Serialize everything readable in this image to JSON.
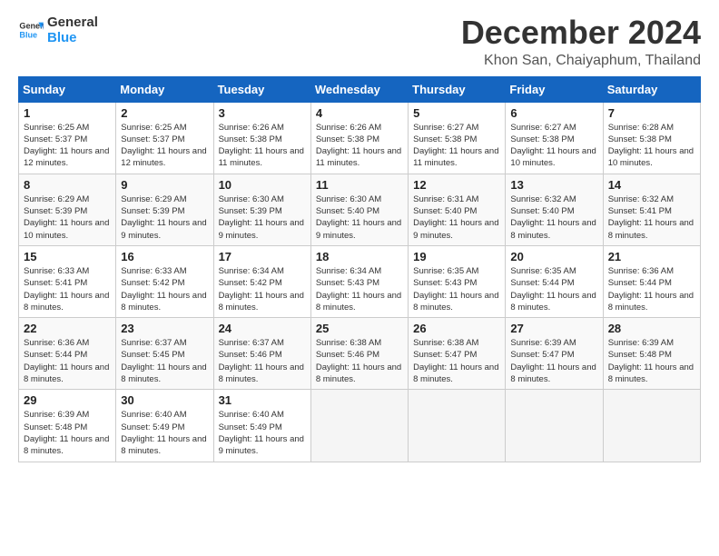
{
  "header": {
    "logo_line1": "General",
    "logo_line2": "Blue",
    "month_title": "December 2024",
    "location": "Khon San, Chaiyaphum, Thailand"
  },
  "weekdays": [
    "Sunday",
    "Monday",
    "Tuesday",
    "Wednesday",
    "Thursday",
    "Friday",
    "Saturday"
  ],
  "weeks": [
    [
      {
        "day": "1",
        "sunrise": "6:25 AM",
        "sunset": "5:37 PM",
        "daylight": "11 hours and 12 minutes."
      },
      {
        "day": "2",
        "sunrise": "6:25 AM",
        "sunset": "5:37 PM",
        "daylight": "11 hours and 12 minutes."
      },
      {
        "day": "3",
        "sunrise": "6:26 AM",
        "sunset": "5:38 PM",
        "daylight": "11 hours and 11 minutes."
      },
      {
        "day": "4",
        "sunrise": "6:26 AM",
        "sunset": "5:38 PM",
        "daylight": "11 hours and 11 minutes."
      },
      {
        "day": "5",
        "sunrise": "6:27 AM",
        "sunset": "5:38 PM",
        "daylight": "11 hours and 11 minutes."
      },
      {
        "day": "6",
        "sunrise": "6:27 AM",
        "sunset": "5:38 PM",
        "daylight": "11 hours and 10 minutes."
      },
      {
        "day": "7",
        "sunrise": "6:28 AM",
        "sunset": "5:38 PM",
        "daylight": "11 hours and 10 minutes."
      }
    ],
    [
      {
        "day": "8",
        "sunrise": "6:29 AM",
        "sunset": "5:39 PM",
        "daylight": "11 hours and 10 minutes."
      },
      {
        "day": "9",
        "sunrise": "6:29 AM",
        "sunset": "5:39 PM",
        "daylight": "11 hours and 9 minutes."
      },
      {
        "day": "10",
        "sunrise": "6:30 AM",
        "sunset": "5:39 PM",
        "daylight": "11 hours and 9 minutes."
      },
      {
        "day": "11",
        "sunrise": "6:30 AM",
        "sunset": "5:40 PM",
        "daylight": "11 hours and 9 minutes."
      },
      {
        "day": "12",
        "sunrise": "6:31 AM",
        "sunset": "5:40 PM",
        "daylight": "11 hours and 9 minutes."
      },
      {
        "day": "13",
        "sunrise": "6:32 AM",
        "sunset": "5:40 PM",
        "daylight": "11 hours and 8 minutes."
      },
      {
        "day": "14",
        "sunrise": "6:32 AM",
        "sunset": "5:41 PM",
        "daylight": "11 hours and 8 minutes."
      }
    ],
    [
      {
        "day": "15",
        "sunrise": "6:33 AM",
        "sunset": "5:41 PM",
        "daylight": "11 hours and 8 minutes."
      },
      {
        "day": "16",
        "sunrise": "6:33 AM",
        "sunset": "5:42 PM",
        "daylight": "11 hours and 8 minutes."
      },
      {
        "day": "17",
        "sunrise": "6:34 AM",
        "sunset": "5:42 PM",
        "daylight": "11 hours and 8 minutes."
      },
      {
        "day": "18",
        "sunrise": "6:34 AM",
        "sunset": "5:43 PM",
        "daylight": "11 hours and 8 minutes."
      },
      {
        "day": "19",
        "sunrise": "6:35 AM",
        "sunset": "5:43 PM",
        "daylight": "11 hours and 8 minutes."
      },
      {
        "day": "20",
        "sunrise": "6:35 AM",
        "sunset": "5:44 PM",
        "daylight": "11 hours and 8 minutes."
      },
      {
        "day": "21",
        "sunrise": "6:36 AM",
        "sunset": "5:44 PM",
        "daylight": "11 hours and 8 minutes."
      }
    ],
    [
      {
        "day": "22",
        "sunrise": "6:36 AM",
        "sunset": "5:44 PM",
        "daylight": "11 hours and 8 minutes."
      },
      {
        "day": "23",
        "sunrise": "6:37 AM",
        "sunset": "5:45 PM",
        "daylight": "11 hours and 8 minutes."
      },
      {
        "day": "24",
        "sunrise": "6:37 AM",
        "sunset": "5:46 PM",
        "daylight": "11 hours and 8 minutes."
      },
      {
        "day": "25",
        "sunrise": "6:38 AM",
        "sunset": "5:46 PM",
        "daylight": "11 hours and 8 minutes."
      },
      {
        "day": "26",
        "sunrise": "6:38 AM",
        "sunset": "5:47 PM",
        "daylight": "11 hours and 8 minutes."
      },
      {
        "day": "27",
        "sunrise": "6:39 AM",
        "sunset": "5:47 PM",
        "daylight": "11 hours and 8 minutes."
      },
      {
        "day": "28",
        "sunrise": "6:39 AM",
        "sunset": "5:48 PM",
        "daylight": "11 hours and 8 minutes."
      }
    ],
    [
      {
        "day": "29",
        "sunrise": "6:39 AM",
        "sunset": "5:48 PM",
        "daylight": "11 hours and 8 minutes."
      },
      {
        "day": "30",
        "sunrise": "6:40 AM",
        "sunset": "5:49 PM",
        "daylight": "11 hours and 8 minutes."
      },
      {
        "day": "31",
        "sunrise": "6:40 AM",
        "sunset": "5:49 PM",
        "daylight": "11 hours and 9 minutes."
      },
      null,
      null,
      null,
      null
    ]
  ],
  "labels": {
    "sunrise": "Sunrise:",
    "sunset": "Sunset:",
    "daylight": "Daylight:"
  }
}
